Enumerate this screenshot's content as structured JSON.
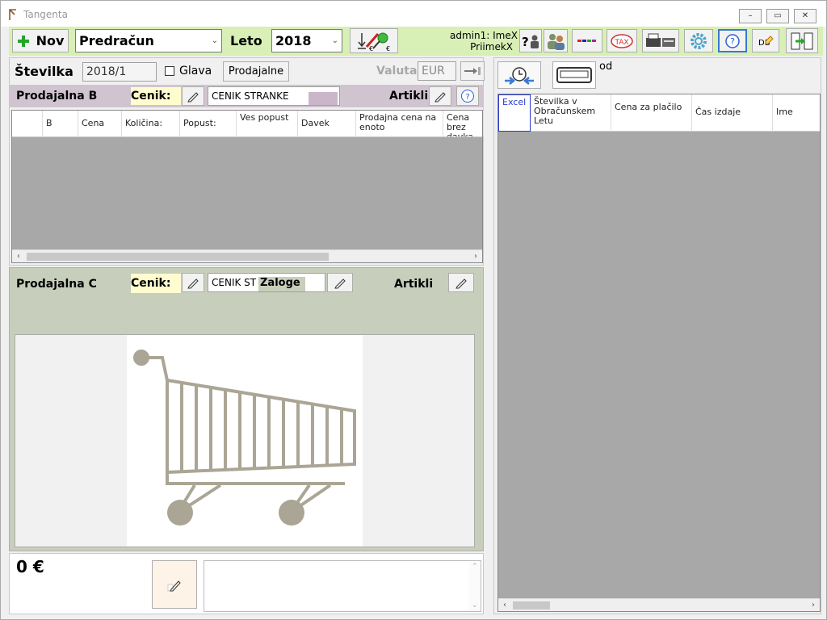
{
  "window": {
    "title": "Tangenta",
    "controls": [
      "–",
      "▭",
      "✕"
    ]
  },
  "toolbar": {
    "new_label": "Nov",
    "doc_type": "Predračun",
    "year_label": "Leto",
    "year_value": "2018",
    "user_line1": "admin1: ImeX",
    "user_line2": "PriimekX",
    "tax_label": "TAX",
    "db_label": "DB"
  },
  "header_row": {
    "number_label": "Številka",
    "number_value": "2018/1",
    "head_label": "Glava",
    "stores_button": "Prodajalne",
    "currency_label": "Valuta",
    "currency_value": "EUR"
  },
  "store_b": {
    "title": "Prodajalna B",
    "pricelist_label": "Cenik:",
    "pricelist_value": "CENIK STRANKE",
    "items_label": "Artikli",
    "columns": [
      "B",
      "Cena",
      "Količina:",
      "Popust:",
      "Ves popust",
      "Davek",
      "Prodajna cena na enoto",
      "Cena brez davka"
    ]
  },
  "store_c": {
    "title": "Prodajalna C",
    "pricelist_label": "Cenik:",
    "pricelist_value": "CENIK ST",
    "stock_label": "Zaloge",
    "items_label": "Artikli"
  },
  "footer": {
    "total": "0 €"
  },
  "right_panel": {
    "od_label": "od",
    "columns": [
      "Excel",
      "Številka v Obračunskem Letu",
      "Cena za plačilo",
      "Čas izdaje",
      "Ime"
    ]
  },
  "colors": {
    "toolbar_bg": "#d8efb6",
    "store_b_bg": "#d1c4d1",
    "store_c_bg": "#c7cebb",
    "cenik_bg": "#fffcd0"
  }
}
